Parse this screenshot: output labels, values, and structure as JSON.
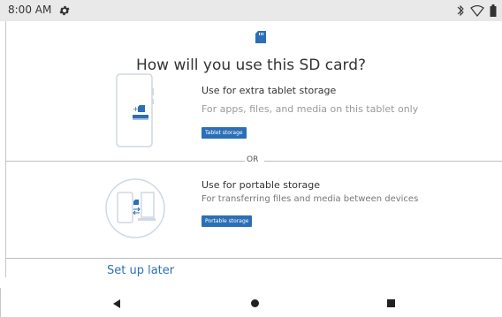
{
  "status_bar": {
    "time": "8:00 AM",
    "icons": [
      "gear-icon",
      "bluetooth-icon",
      "wifi-icon",
      "battery-icon"
    ]
  },
  "main": {
    "title": "How will you use this SD card?",
    "option1": {
      "title": "Use for extra tablet storage",
      "description": "For apps, files, and media on this tablet only",
      "button": "Tablet storage"
    },
    "or_label": "OR",
    "option2": {
      "title": "Use for portable storage",
      "description": "For transferring files and media between devices",
      "button": "Portable storage"
    },
    "setup_later": "Set up later"
  },
  "nav": {
    "icons": [
      "back-icon",
      "home-icon",
      "recents-icon"
    ]
  },
  "colors": {
    "accent": "#2c6fb6",
    "link": "#2d6fb4",
    "status_bar_bg": "#e9e9e9"
  }
}
